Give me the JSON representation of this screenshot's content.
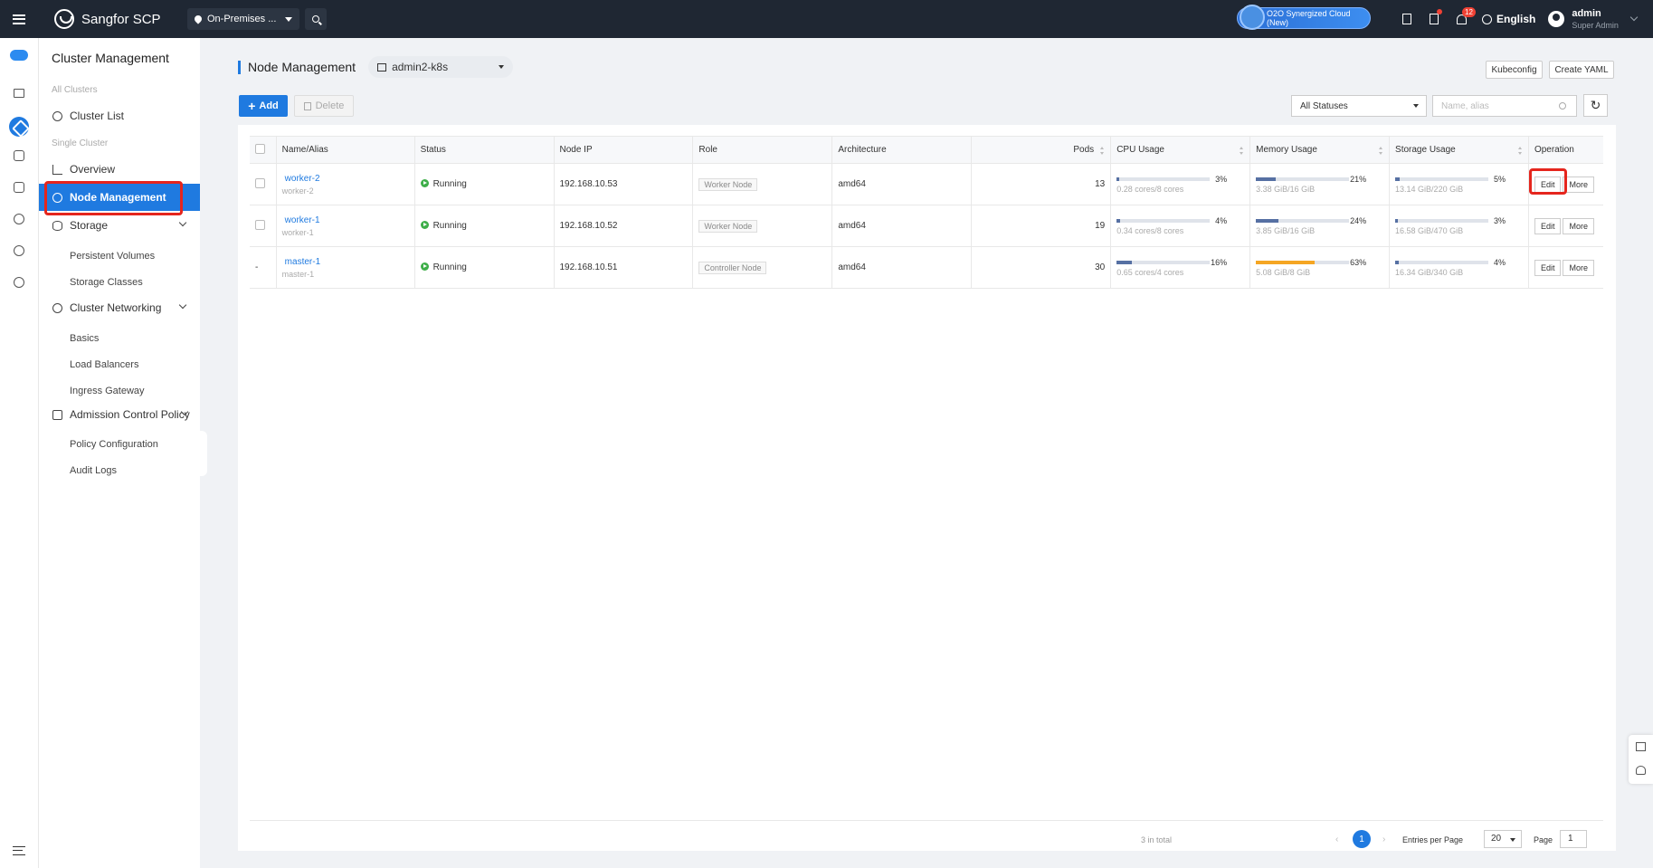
{
  "topbar": {
    "brand": "Sangfor SCP",
    "location": "On-Premises ...",
    "o2o_label": "O2O Synergized Cloud (New)",
    "notification_count": "12",
    "language": "English",
    "user_name": "admin",
    "user_role": "Super Admin"
  },
  "sidebar": {
    "title": "Cluster Management",
    "group_all": "All Clusters",
    "cluster_list": "Cluster List",
    "group_single": "Single Cluster",
    "overview": "Overview",
    "node_management": "Node Management",
    "storage": "Storage",
    "persistent_volumes": "Persistent Volumes",
    "storage_classes": "Storage Classes",
    "cluster_networking": "Cluster Networking",
    "basics": "Basics",
    "load_balancers": "Load Balancers",
    "ingress_gateway": "Ingress Gateway",
    "admission_control": "Admission Control Policy",
    "policy_configuration": "Policy Configuration",
    "audit_logs": "Audit Logs"
  },
  "header": {
    "title": "Node Management",
    "cluster": "admin2-k8s",
    "kubeconfig": "Kubeconfig",
    "create_yaml": "Create YAML"
  },
  "toolbar": {
    "add": "Add",
    "delete": "Delete",
    "status_filter": "All Statuses",
    "search_placeholder": "Name, alias"
  },
  "table": {
    "columns": [
      "Name/Alias",
      "Status",
      "Node IP",
      "Role",
      "Architecture",
      "Pods",
      "CPU Usage",
      "Memory Usage",
      "Storage Usage",
      "Operation"
    ],
    "rows": [
      {
        "checkbox": "",
        "name": "worker-2",
        "alias": "worker-2",
        "status": "Running",
        "ip": "192.168.10.53",
        "role": "Worker Node",
        "arch": "amd64",
        "pods": "13",
        "cpu_pct": "3%",
        "cpu_val": 3,
        "cpu_sub": "0.28 cores/8 cores",
        "mem_pct": "21%",
        "mem_val": 21,
        "mem_sub": "3.38 GiB/16 GiB",
        "sto_pct": "5%",
        "sto_val": 5,
        "sto_sub": "13.14 GiB/220 GiB",
        "edit": "Edit",
        "more": "More"
      },
      {
        "checkbox": "",
        "name": "worker-1",
        "alias": "worker-1",
        "status": "Running",
        "ip": "192.168.10.52",
        "role": "Worker Node",
        "arch": "amd64",
        "pods": "19",
        "cpu_pct": "4%",
        "cpu_val": 4,
        "cpu_sub": "0.34 cores/8 cores",
        "mem_pct": "24%",
        "mem_val": 24,
        "mem_sub": "3.85 GiB/16 GiB",
        "sto_pct": "3%",
        "sto_val": 3,
        "sto_sub": "16.58 GiB/470 GiB",
        "edit": "Edit",
        "more": "More"
      },
      {
        "checkbox": "-",
        "name": "master-1",
        "alias": "master-1",
        "status": "Running",
        "ip": "192.168.10.51",
        "role": "Controller Node",
        "arch": "amd64",
        "pods": "30",
        "cpu_pct": "16%",
        "cpu_val": 16,
        "cpu_sub": "0.65 cores/4 cores",
        "mem_pct": "63%",
        "mem_val": 63,
        "mem_sub": "5.08 GiB/8 GiB",
        "sto_pct": "4%",
        "sto_val": 4,
        "sto_sub": "16.34 GiB/340 GiB",
        "edit": "Edit",
        "more": "More"
      }
    ]
  },
  "pagination": {
    "total": "3 in total",
    "prev": "‹",
    "current": "1",
    "next": "›",
    "per_page_label": "Entries per Page",
    "per_page": "20",
    "page_label": "Page",
    "page": "1"
  },
  "colors": {
    "accent": "#1f7ae0",
    "bar_normal": "#5670a3",
    "bar_warning": "#f5a623",
    "running": "#3eae49",
    "highlight": "#e5251d"
  }
}
